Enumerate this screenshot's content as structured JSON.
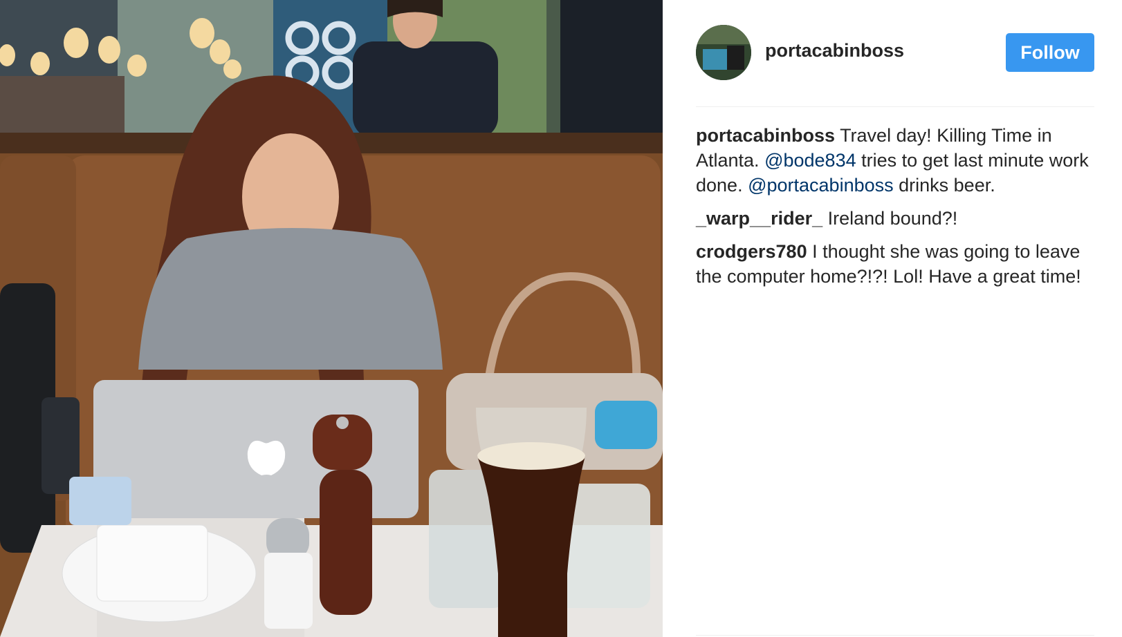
{
  "post": {
    "username": "portacabinboss",
    "follow_label": "Follow",
    "photo_alt": "woman working on a laptop in a restaurant booth with a glass of beer"
  },
  "comments": [
    {
      "author": "portacabinboss",
      "text_1": "Travel day! Killing Time in Atlanta.",
      "mention_1": "@bode834",
      "text_2": "tries to get last minute work done.",
      "mention_2": "@portacabinboss",
      "text_3": "drinks beer."
    },
    {
      "author": "_warp__rider_",
      "text": "Ireland bound?!"
    },
    {
      "author": "crodgers780",
      "text": "I thought she was going to leave the computer home?!?! Lol! Have a great time!"
    }
  ],
  "colors": {
    "follow_button": "#3897f0",
    "mention": "#003569",
    "text": "#262626"
  }
}
